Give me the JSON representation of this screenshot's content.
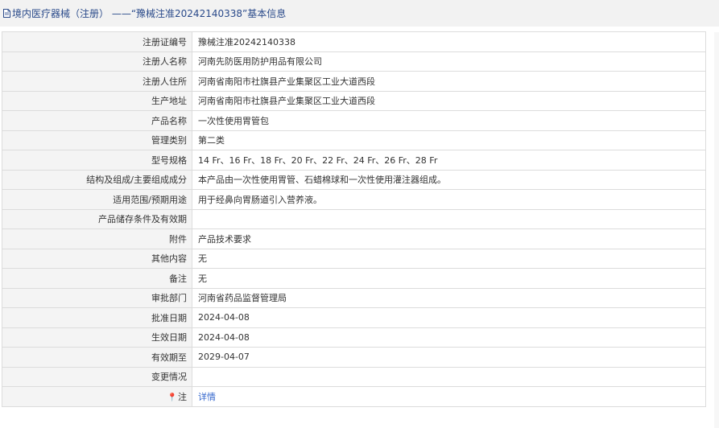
{
  "header": {
    "title": "境内医疗器械（注册） ——“豫械注准20242140338”基本信息"
  },
  "rows": [
    {
      "label": "注册证编号",
      "value": "豫械注准20242140338"
    },
    {
      "label": "注册人名称",
      "value": "河南先防医用防护用品有限公司"
    },
    {
      "label": "注册人住所",
      "value": "河南省南阳市社旗县产业集聚区工业大道西段"
    },
    {
      "label": "生产地址",
      "value": "河南省南阳市社旗县产业集聚区工业大道西段"
    },
    {
      "label": "产品名称",
      "value": "一次性使用胃管包"
    },
    {
      "label": "管理类别",
      "value": "第二类"
    },
    {
      "label": "型号规格",
      "value": "14 Fr、16 Fr、18 Fr、20 Fr、22 Fr、24 Fr、26 Fr、28 Fr"
    },
    {
      "label": "结构及组成/主要组成成分",
      "value": "本产品由一次性使用胃管、石蜡棉球和一次性使用灌注器组成。"
    },
    {
      "label": "适用范围/预期用途",
      "value": "用于经鼻向胃肠道引入营养液。"
    },
    {
      "label": "产品储存条件及有效期",
      "value": ""
    },
    {
      "label": "附件",
      "value": "产品技术要求"
    },
    {
      "label": "其他内容",
      "value": "无"
    },
    {
      "label": "备注",
      "value": "无"
    },
    {
      "label": "审批部门",
      "value": "河南省药品监督管理局"
    },
    {
      "label": "批准日期",
      "value": "2024-04-08"
    },
    {
      "label": "生效日期",
      "value": "2024-04-08"
    },
    {
      "label": "有效期至",
      "value": "2029-04-07"
    },
    {
      "label": "变更情况",
      "value": ""
    }
  ],
  "note": {
    "icon": "pin-icon",
    "label": "注",
    "link_text": "详情"
  },
  "colors": {
    "title_text": "#2a4a8a",
    "label_bg": "#f4f4f4",
    "border": "#dcdcdc",
    "link": "#3366cc"
  }
}
